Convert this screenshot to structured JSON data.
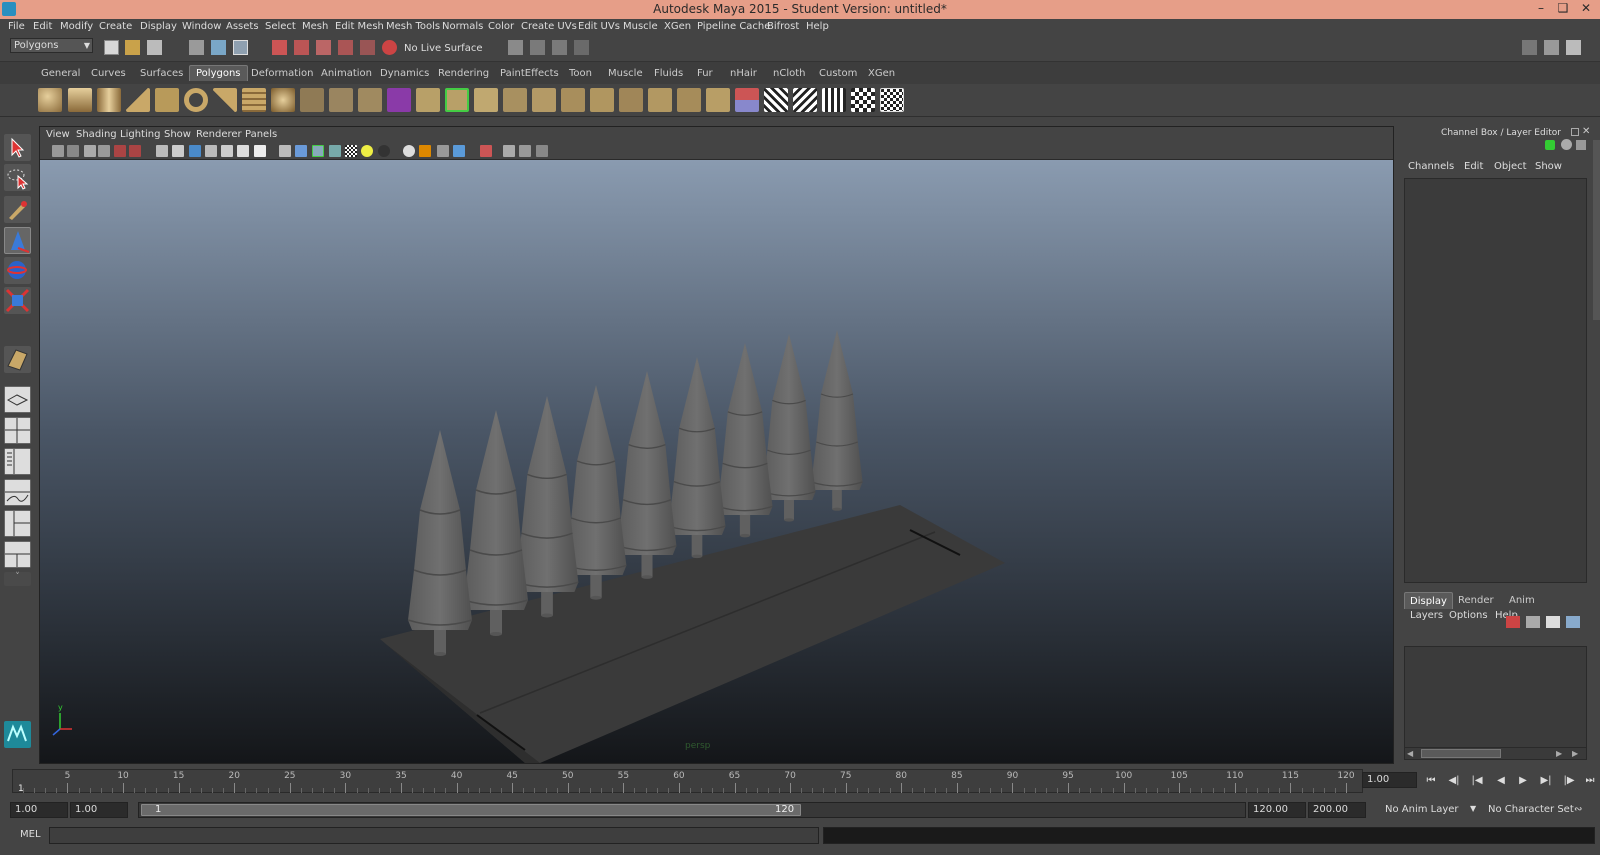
{
  "window": {
    "title": "Autodesk Maya 2015 - Student Version: untitled*"
  },
  "menubar": [
    "File",
    "Edit",
    "Modify",
    "Create",
    "Display",
    "Window",
    "Assets",
    "Select",
    "Mesh",
    "Edit Mesh",
    "Mesh Tools",
    "Normals",
    "Color",
    "Create UVs",
    "Edit UVs",
    "Muscle",
    "XGen",
    "Pipeline Cache",
    "Bifrost",
    "Help"
  ],
  "statusline": {
    "mode": "Polygons",
    "live_surface": "No Live Surface"
  },
  "shelf_tabs": [
    "General",
    "Curves",
    "Surfaces",
    "Polygons",
    "Deformation",
    "Animation",
    "Dynamics",
    "Rendering",
    "PaintEffects",
    "Toon",
    "Muscle",
    "Fluids",
    "Fur",
    "nHair",
    "nCloth",
    "Custom",
    "XGen"
  ],
  "shelf_active": "Polygons",
  "viewport": {
    "menus": [
      "View",
      "Shading",
      "Lighting",
      "Show",
      "Renderer",
      "Panels"
    ],
    "camera_label": "persp",
    "axis": {
      "x": "x",
      "y": "y",
      "z": "z"
    }
  },
  "channel_box": {
    "title": "Channel Box / Layer Editor",
    "menus": [
      "Channels",
      "Edit",
      "Object",
      "Show"
    ]
  },
  "layer_editor": {
    "tabs": [
      "Display",
      "Render",
      "Anim"
    ],
    "active_tab": "Display",
    "menus": [
      "Layers",
      "Options",
      "Help"
    ]
  },
  "timeline": {
    "ticks": [
      "5",
      "10",
      "15",
      "20",
      "25",
      "30",
      "35",
      "40",
      "45",
      "50",
      "55",
      "60",
      "65",
      "70",
      "75",
      "80",
      "85",
      "90",
      "95",
      "100",
      "105",
      "110",
      "115",
      "120"
    ],
    "current_frame": "1",
    "current_field": "1.00"
  },
  "range": {
    "start": "1.00",
    "playback_start": "1.00",
    "slider_start": "1",
    "slider_end": "120",
    "playback_end": "120.00",
    "end": "200.00",
    "anim_layer": "No Anim Layer",
    "character_set": "No Character Set"
  },
  "command": {
    "label": "MEL"
  }
}
